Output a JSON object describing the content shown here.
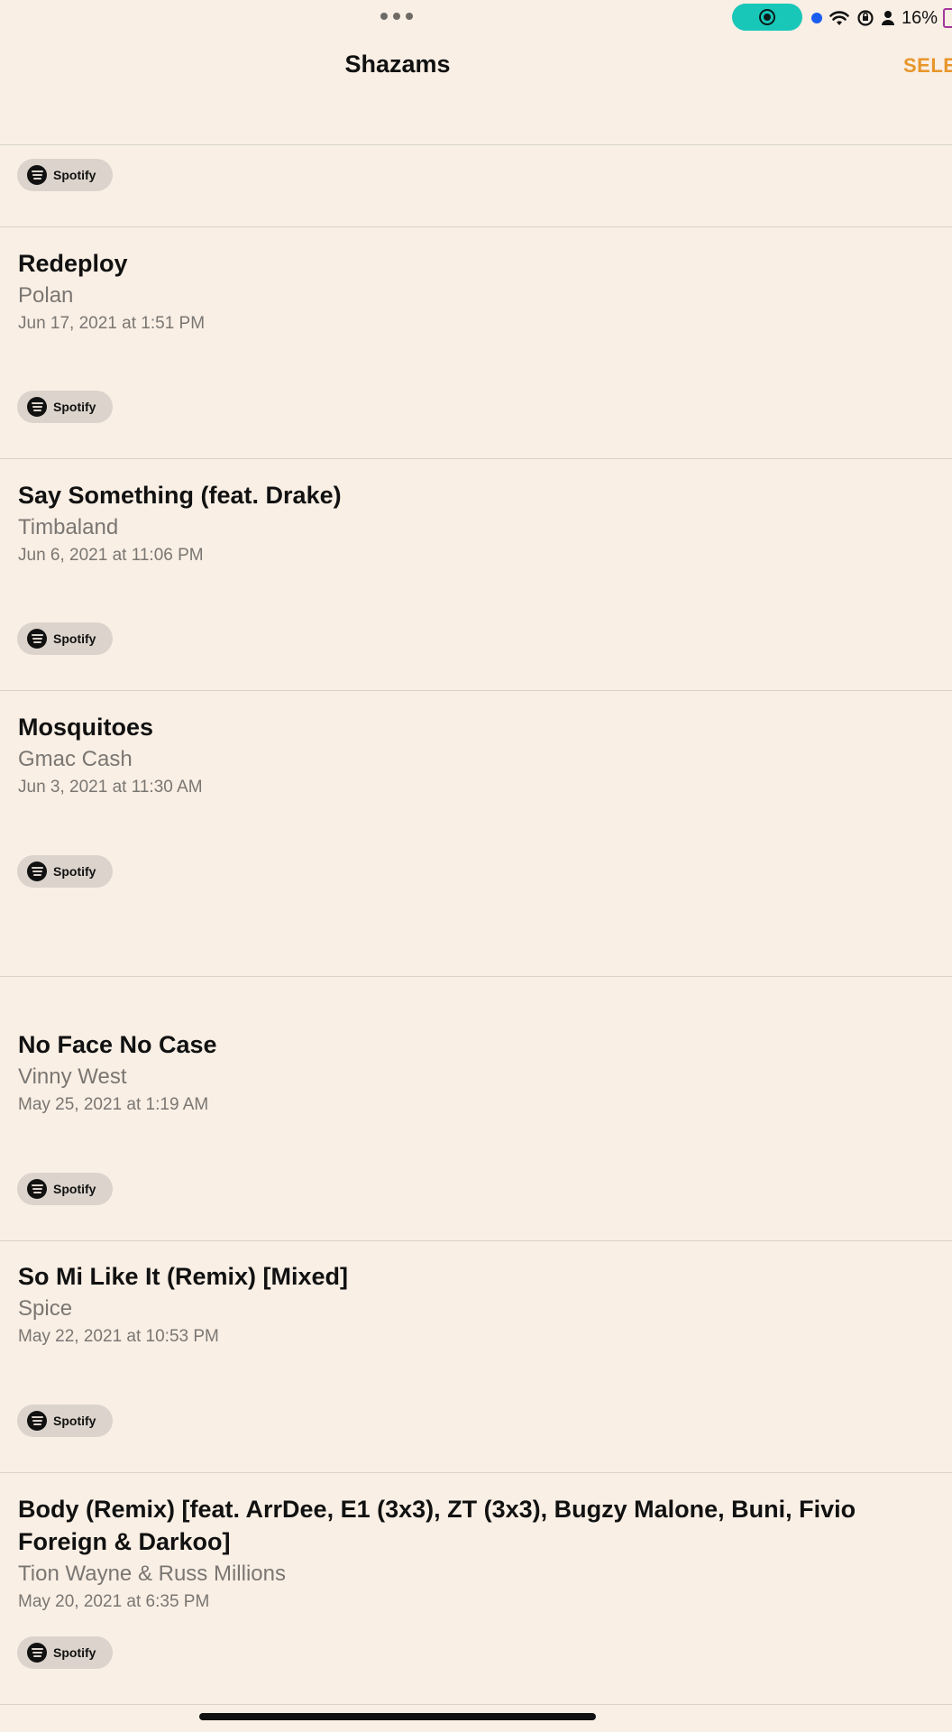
{
  "status_bar": {
    "battery": "16%"
  },
  "nav": {
    "title": "Shazams",
    "select_label": "SELE"
  },
  "spotify_label": "Spotify",
  "songs": [
    {
      "title": "Redeploy",
      "artist": "Polan",
      "date": "Jun 17, 2021 at 1:51 PM"
    },
    {
      "title": "Say Something (feat. Drake)",
      "artist": "Timbaland",
      "date": "Jun 6, 2021 at 11:06 PM"
    },
    {
      "title": "Mosquitoes",
      "artist": "Gmac Cash",
      "date": "Jun 3, 2021 at 11:30 AM"
    },
    {
      "title": "No Face No Case",
      "artist": "Vinny West",
      "date": "May 25, 2021 at 1:19 AM"
    },
    {
      "title": "So Mi Like It (Remix) [Mixed]",
      "artist": "Spice",
      "date": "May 22, 2021 at 10:53 PM"
    },
    {
      "title": "Body (Remix) [feat. ArrDee, E1 (3x3), ZT (3x3), Bugzy Malone, Buni, Fivio Foreign & Darkoo]",
      "artist": "Tion Wayne & Russ Millions",
      "date": "May 20, 2021 at 6:35 PM"
    }
  ],
  "colors": {
    "background": "#f9efe5",
    "accent": "#e8962a",
    "record_pill": "#18c7b8"
  }
}
